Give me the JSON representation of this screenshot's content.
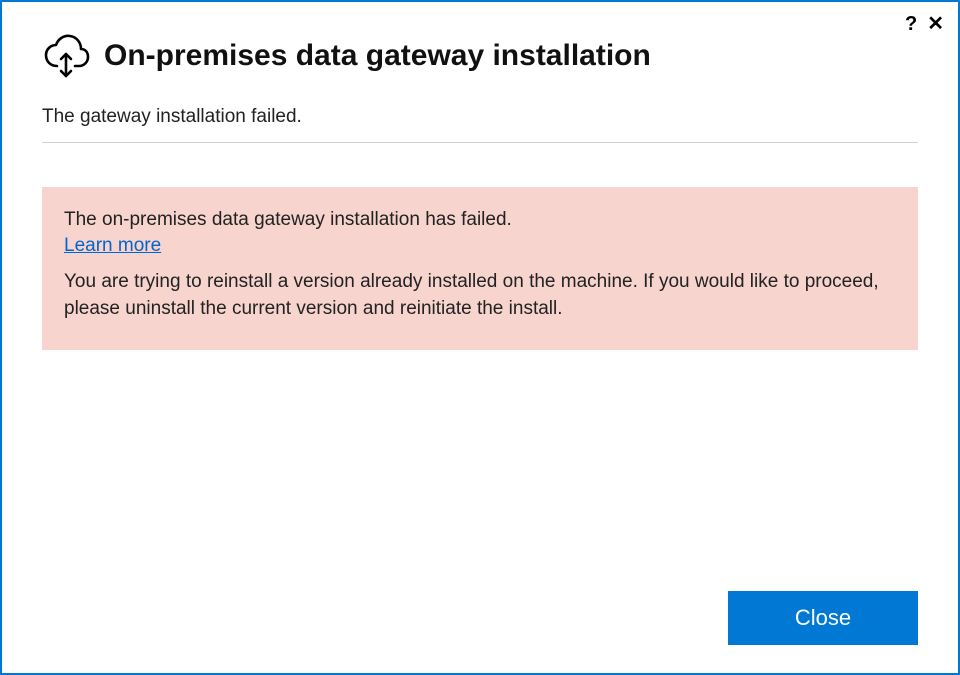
{
  "titlebar": {
    "help_tooltip": "?",
    "close_tooltip": "✕"
  },
  "header": {
    "title": "On-premises data gateway installation"
  },
  "status": {
    "message": "The gateway installation failed."
  },
  "alert": {
    "title": "The on-premises data gateway installation has failed.",
    "learn_more_label": "Learn more",
    "body": "You are trying to reinstall a version already installed on the machine. If you would like to proceed, please uninstall the current version and reinitiate the install."
  },
  "footer": {
    "close_label": "Close"
  }
}
